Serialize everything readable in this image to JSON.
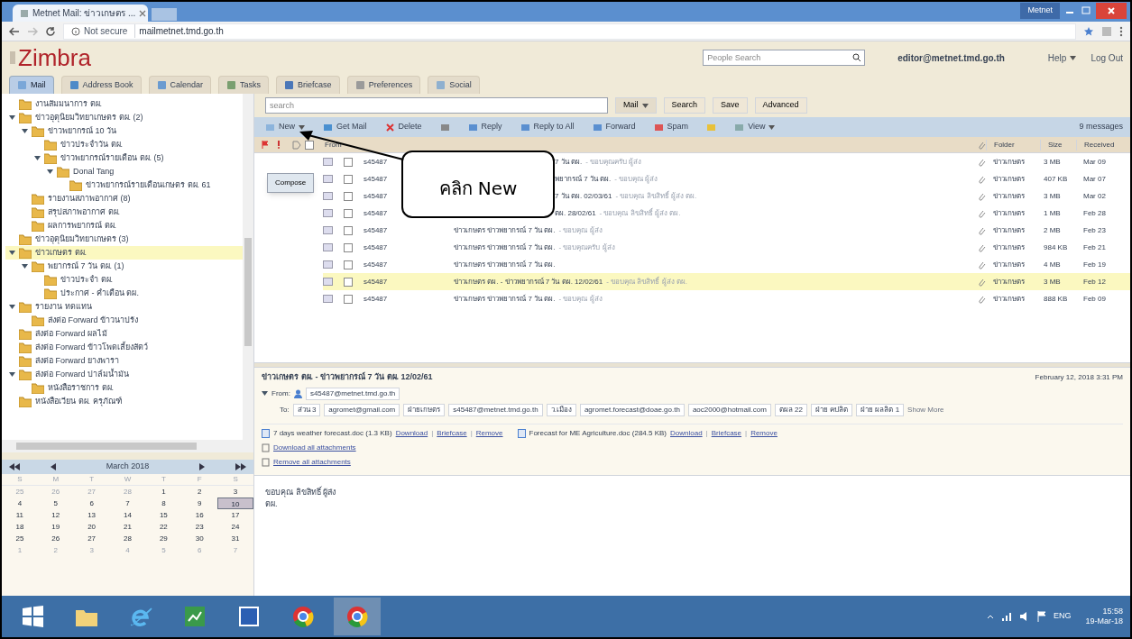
{
  "browser": {
    "tab_title": "Metnet Mail: ข่าวเกษตร ...",
    "security": "Not secure",
    "url": "mailmetnet.tmd.go.th",
    "window_label": "Metnet"
  },
  "header": {
    "logo": "Zimbra",
    "people_search": {
      "placeholder": "People Search"
    },
    "user": "editor@metnet.tmd.go.th",
    "help": "Help",
    "logout": "Log Out"
  },
  "app_tabs": [
    {
      "label": "Mail",
      "selected": true
    },
    {
      "label": "Address Book",
      "selected": false
    },
    {
      "label": "Calendar",
      "selected": false
    },
    {
      "label": "Tasks",
      "selected": false
    },
    {
      "label": "Briefcase",
      "selected": false
    },
    {
      "label": "Preferences",
      "selected": false
    },
    {
      "label": "Social",
      "selected": false
    }
  ],
  "folders": [
    {
      "label": "งานสัมมนาการ ตผ.",
      "selected": false
    },
    {
      "label": "ข่าวอุตุนิยมวิทยาเกษตร ตผ. (2)",
      "expanded": true,
      "selected": false,
      "children": [
        {
          "label": "ข่าวพยากรณ์ 10 วัน",
          "expanded": true,
          "selected": false,
          "children": [
            {
              "label": "ข่าวประจำวัน ตผ.",
              "selected": false
            },
            {
              "label": "ข่าวพยากรณ์รายเดือน ตผ. (5)",
              "expanded": true,
              "selected": false,
              "children": [
                {
                  "label": "Donal Tang",
                  "expanded": true,
                  "selected": false,
                  "children": [
                    {
                      "label": "ข่าวพยากรณ์รายเดือนเกษตร ตผ. 61",
                      "selected": false
                    }
                  ]
                }
              ]
            }
          ]
        },
        {
          "label": "รายงานสภาพอากาศ (8)",
          "selected": false
        },
        {
          "label": "สรุปสภาพอากาศ ตผ.",
          "selected": false
        },
        {
          "label": "ผลการพยากรณ์ ตผ.",
          "selected": false
        }
      ]
    },
    {
      "label": "ข่าวอุตุนิยมวิทยาเกษตร (3)",
      "selected": false
    },
    {
      "label": "ข่าวเกษตร ตผ.",
      "expanded": true,
      "selected": true,
      "children": [
        {
          "label": "พยากรณ์ 7 วัน ตผ. (1)",
          "expanded": true,
          "selected": false,
          "children": [
            {
              "label": "ข่าวประจำ ตผ.",
              "selected": false
            },
            {
              "label": "ประกาศ - คำเตือน ตผ.",
              "selected": false
            }
          ]
        }
      ]
    },
    {
      "label": "รายงาน ทดแทน",
      "expanded": true,
      "selected": false,
      "children": [
        {
          "label": "ส่งต่อ Forward ข้าวนาปรัง",
          "selected": false
        }
      ]
    },
    {
      "label": "ส่งต่อ Forward ผลไม้",
      "selected": false
    },
    {
      "label": "ส่งต่อ Forward ข้าวโพดเลี้ยงสัตว์",
      "selected": false
    },
    {
      "label": "ส่งต่อ Forward ยางพารา",
      "selected": false
    },
    {
      "label": "ส่งต่อ Forward ปาล์มน้ำมัน",
      "expanded": true,
      "selected": false,
      "children": [
        {
          "label": "หนังสือราชการ ตผ.",
          "selected": false
        }
      ]
    },
    {
      "label": "หนังสือเวียน ตผ. ครุภัณฑ์",
      "selected": false
    }
  ],
  "calendar": {
    "month": "March 2018",
    "weekdays": [
      "S",
      "M",
      "T",
      "W",
      "T",
      "F",
      "S"
    ],
    "days": [
      {
        "day": "25",
        "other_month": true,
        "selected": false
      },
      {
        "day": "26",
        "other_month": true,
        "selected": false
      },
      {
        "day": "27",
        "other_month": true,
        "selected": false
      },
      {
        "day": "28",
        "other_month": true,
        "selected": false
      },
      {
        "day": "1",
        "other_month": false,
        "selected": false
      },
      {
        "day": "2",
        "other_month": false,
        "selected": false
      },
      {
        "day": "3",
        "other_month": false,
        "selected": false
      },
      {
        "day": "4",
        "other_month": false,
        "selected": false
      },
      {
        "day": "5",
        "other_month": false,
        "selected": false
      },
      {
        "day": "6",
        "other_month": false,
        "selected": false
      },
      {
        "day": "7",
        "other_month": false,
        "selected": false
      },
      {
        "day": "8",
        "other_month": false,
        "selected": false
      },
      {
        "day": "9",
        "other_month": false,
        "selected": false
      },
      {
        "day": "10",
        "other_month": false,
        "selected": true
      },
      {
        "day": "11",
        "other_month": false,
        "selected": false
      },
      {
        "day": "12",
        "other_month": false,
        "selected": false
      },
      {
        "day": "13",
        "other_month": false,
        "selected": false
      },
      {
        "day": "14",
        "other_month": false,
        "selected": false
      },
      {
        "day": "15",
        "other_month": false,
        "selected": false
      },
      {
        "day": "16",
        "other_month": false,
        "selected": false
      },
      {
        "day": "17",
        "other_month": false,
        "selected": false
      },
      {
        "day": "18",
        "other_month": false,
        "selected": false
      },
      {
        "day": "19",
        "other_month": false,
        "selected": false
      },
      {
        "day": "20",
        "other_month": false,
        "selected": false
      },
      {
        "day": "21",
        "other_month": false,
        "selected": false
      },
      {
        "day": "22",
        "other_month": false,
        "selected": false
      },
      {
        "day": "23",
        "other_month": false,
        "selected": false
      },
      {
        "day": "24",
        "other_month": false,
        "selected": false
      },
      {
        "day": "25",
        "other_month": false,
        "selected": false
      },
      {
        "day": "26",
        "other_month": false,
        "selected": false
      },
      {
        "day": "27",
        "other_month": false,
        "selected": false
      },
      {
        "day": "28",
        "other_month": false,
        "selected": false
      },
      {
        "day": "29",
        "other_month": false,
        "selected": false
      },
      {
        "day": "30",
        "other_month": false,
        "selected": false
      },
      {
        "day": "31",
        "other_month": false,
        "selected": false
      },
      {
        "day": "1",
        "other_month": true,
        "selected": false
      },
      {
        "day": "2",
        "other_month": true,
        "selected": false
      },
      {
        "day": "3",
        "other_month": true,
        "selected": false
      },
      {
        "day": "4",
        "other_month": true,
        "selected": false
      },
      {
        "day": "5",
        "other_month": true,
        "selected": false
      },
      {
        "day": "6",
        "other_month": true,
        "selected": false
      },
      {
        "day": "7",
        "other_month": true,
        "selected": false
      }
    ]
  },
  "search": {
    "placeholder": "search",
    "scope": "Mail",
    "buttons": [
      "Search",
      "Save",
      "Advanced"
    ]
  },
  "toolbar": {
    "buttons": [
      {
        "kind": "new",
        "label": "New"
      },
      {
        "kind": "getmail",
        "label": "Get Mail"
      },
      {
        "kind": "delete",
        "label": "Delete"
      },
      {
        "kind": "print"
      },
      {
        "kind": "reply",
        "label": "Reply"
      },
      {
        "kind": "replyall",
        "label": "Reply to All"
      },
      {
        "kind": "forward",
        "label": "Forward"
      },
      {
        "kind": "spam",
        "label": "Spam"
      },
      {
        "kind": "tag"
      },
      {
        "kind": "view",
        "label": "View"
      }
    ],
    "count": "9 messages"
  },
  "compose_menu": {
    "item": "Compose"
  },
  "columns": {
    "from": "From",
    "folder": "Folder",
    "size": "Size",
    "received": "Received"
  },
  "messages": [
    {
      "kind": "covered",
      "from": "s45487",
      "subject": "7 วัน ตผ.",
      "fragment": "- ขอบคุณครับ ผู้ส่ง",
      "folder": "ข่าวเกษตร",
      "size": "3 MB",
      "received": "Mar 09",
      "selected": false
    },
    {
      "kind": "covered",
      "from": "s45487",
      "subject": "พยากรณ์ 7 วัน ตผ.",
      "fragment": "- ขอบคุณ ผู้ส่ง",
      "folder": "ข่าวเกษตร",
      "size": "407 KB",
      "received": "Mar 07",
      "selected": false
    },
    {
      "kind": "covered",
      "from": "s45487",
      "subject": "7 วัน ตผ. 02/03/61",
      "fragment": "- ขอบคุณ ลิขสิทธิ์ ผู้ส่ง ตผ.",
      "folder": "ข่าวเกษตร",
      "size": "3 MB",
      "received": "Mar 02",
      "selected": false
    },
    {
      "kind": "covered",
      "from": "s45487",
      "subject": "ตผ. 28/02/61",
      "fragment": "- ขอบคุณ ลิขสิทธิ์ ผู้ส่ง ตผ.",
      "folder": "ข่าวเกษตร",
      "size": "1 MB",
      "received": "Feb 28",
      "selected": false
    },
    {
      "from": "s45487",
      "subject": "ข่าวเกษตร ข่าวพยากรณ์ 7 วัน ตผ.",
      "fragment": "- ขอบคุณ ผู้ส่ง",
      "folder": "ข่าวเกษตร",
      "size": "2 MB",
      "received": "Feb 23",
      "selected": false
    },
    {
      "from": "s45487",
      "subject": "ข่าวเกษตร ข่าวพยากรณ์ 7 วัน ตผ.",
      "fragment": "- ขอบคุณครับ ผู้ส่ง",
      "folder": "ข่าวเกษตร",
      "size": "984 KB",
      "received": "Feb 21",
      "selected": false
    },
    {
      "from": "s45487",
      "subject": "ข่าวเกษตร ข่าวพยากรณ์ 7 วัน ตผ.",
      "folder": "ข่าวเกษตร",
      "size": "4 MB",
      "received": "Feb 19",
      "selected": false
    },
    {
      "from": "s45487",
      "subject": "ข่าวเกษตร ตผ. - ข่าวพยากรณ์ 7 วัน ตผ. 12/02/61",
      "fragment": "- ขอบคุณ ลิขสิทธิ์ ผู้ส่ง ตผ.",
      "folder": "ข่าวเกษตร",
      "size": "3 MB",
      "received": "Feb 12",
      "selected": true
    },
    {
      "from": "s45487",
      "subject": "ข่าวเกษตร ข่าวพยากรณ์ 7 วัน ตผ.",
      "fragment": "- ขอบคุณ ผู้ส่ง",
      "folder": "ข่าวเกษตร",
      "size": "888 KB",
      "received": "Feb 09",
      "selected": false
    }
  ],
  "reading": {
    "subject": "ข่าวเกษตร ตผ. - ข่าวพยากรณ์ 7 วัน ตผ. 12/02/61",
    "date": "February 12, 2018 3:31 PM",
    "from_label": "From:",
    "from": "s45487@metnet.tmd.go.th",
    "to_label": "To:",
    "link_separator": "|",
    "to": [
      "ส่วน 3",
      "agromet@gmail.com",
      "ฝ่ายเกษตร",
      "s45487@metnet.tmd.go.th",
      "ว.เมือง",
      "agromet.forecast@doae.go.th",
      "aoc2000@hotmail.com",
      "ตผล 22",
      "ฝ่าย คปลิต",
      "ฝ่าย ผลลิต 1"
    ],
    "show_more": "Show More",
    "attachments": [
      {
        "name": "7 days weather forecast.doc (1.3 KB)",
        "links": [
          "Download",
          "Briefcase",
          "Remove"
        ]
      },
      {
        "name": "Forecast for ME Agriculture.doc (284.5 KB)",
        "links": [
          "Download",
          "Briefcase",
          "Remove"
        ]
      }
    ],
    "all_links": [
      "Download all attachments",
      "Remove all attachments"
    ],
    "body": [
      "ขอบคุณ ลิขสิทธิ์ ผู้ส่ง",
      "ตผ."
    ]
  },
  "taskbar": {
    "apps": [
      {
        "kind": "start"
      },
      {
        "kind": "explorer"
      },
      {
        "kind": "ie"
      },
      {
        "kind": "sheet"
      },
      {
        "kind": "word"
      },
      {
        "kind": "chrome"
      },
      {
        "kind": "chrome-active"
      }
    ],
    "lang": "ENG",
    "time": "15:58",
    "date": "19-Mar-18"
  },
  "callout": {
    "text": "คลิก New"
  }
}
